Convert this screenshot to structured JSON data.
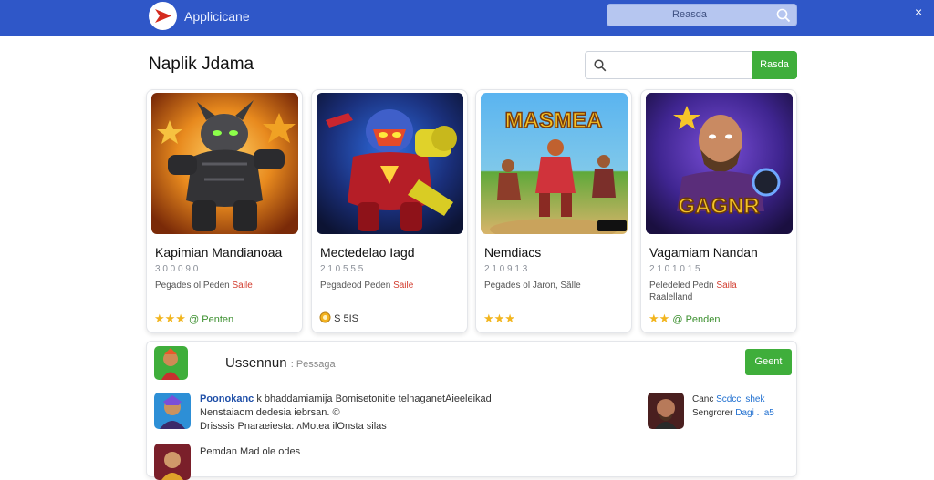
{
  "topbar": {
    "app_title": "Applicicane",
    "search_label": "Reasda",
    "logo_color": "#d42b1e",
    "bar_color": "#2f57c8",
    "close_icon": "×"
  },
  "header": {
    "title": "Naplik Jdama",
    "search_placeholder": "",
    "search_button": "Rasda"
  },
  "cards": [
    {
      "title": "Kapimian Mandianoaa",
      "sub": "3 0 0 0 9 0",
      "desc": "Pegades ol Peden",
      "sale": "Saile",
      "desc2": "",
      "rating_prefix": "★★★",
      "rating_text": "@ Penten"
    },
    {
      "title": "Mectedelao Iagd",
      "sub": "2 1 0 5 5 5",
      "desc": "Pegadeod Peden",
      "sale": "Saile",
      "desc2": "",
      "rating_prefix": "",
      "rating_text": "S 5IS"
    },
    {
      "title": "Nemdiacs",
      "sub": "2 1 0 9 1 3",
      "desc": "Pegades ol Jaron, Sâlle",
      "sale": "",
      "desc2": "",
      "rating_prefix": "★★★",
      "rating_text": ""
    },
    {
      "title": "Vagamiam Nandan",
      "sub": "2 1 0 1 0 1 5",
      "desc": "Peledeled Pedn",
      "sale": "Saila",
      "desc2": "Raalelland",
      "rating_prefix": "★★",
      "rating_text": "@ Penden"
    }
  ],
  "card_art": [
    "MASMEA",
    "GAGNR"
  ],
  "panel": {
    "title": "Ussennun",
    "title_tag": ": Pessaga",
    "button": "Geent",
    "rows": [
      {
        "lead": "Poonokanc",
        "line1": " k bhaddamiamija Bomisetonitie telnaganetAieeleikad",
        "line2": "Nenstaiaom dedesia iebrsan. ©",
        "line3": "Drisssis Pnaraeiesta: ʌMotea ilOnsta silas"
      },
      {
        "lead": "Pemdan",
        "line1": " Mad ole odes",
        "line2": "",
        "line3": ""
      }
    ],
    "side_item": {
      "name": "Canc",
      "name_accent": " Scdcci shek",
      "meta": "Sengrorer",
      "meta_accent": " Dagi . |a5"
    }
  }
}
